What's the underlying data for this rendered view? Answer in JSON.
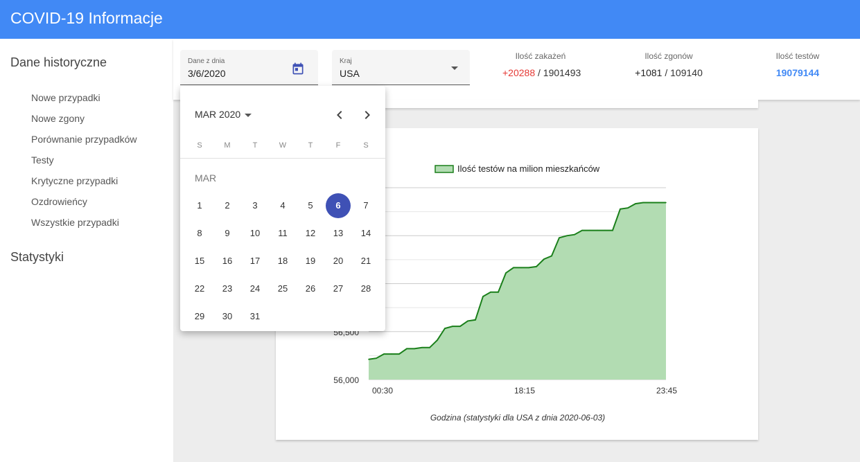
{
  "app": {
    "title": "COVID-19 Informacje"
  },
  "sidebar": {
    "heading_history": "Dane historyczne",
    "items": [
      {
        "label": "Nowe przypadki"
      },
      {
        "label": "Nowe zgony"
      },
      {
        "label": "Porównanie przypadków"
      },
      {
        "label": "Testy"
      },
      {
        "label": "Krytyczne przypadki"
      },
      {
        "label": "Ozdrowieńcy"
      },
      {
        "label": "Wszystkie przypadki"
      }
    ],
    "heading_stats": "Statystyki"
  },
  "filters": {
    "date": {
      "label": "Dane z dnia",
      "value": "3/6/2020",
      "icon": "calendar-icon"
    },
    "country": {
      "label": "Kraj",
      "value": "USA",
      "icon": "chevron-down-icon"
    }
  },
  "stats": {
    "infections": {
      "label": "Ilość zakażeń",
      "delta": "+20288",
      "sep": " / ",
      "total": "1901493"
    },
    "deaths": {
      "label": "Ilość zgonów",
      "delta": "+1081",
      "sep": " / ",
      "total": "109140"
    },
    "tests": {
      "label": "Ilość testów",
      "total": "19079144"
    }
  },
  "datepicker": {
    "period_label": "MAR 2020",
    "month_label": "MAR",
    "weekdays": [
      "S",
      "M",
      "T",
      "W",
      "T",
      "F",
      "S"
    ],
    "first_weekday_index": 0,
    "days_in_month": 31,
    "selected_day": 6,
    "prev_icon": "chevron-left-icon",
    "next_icon": "chevron-right-icon",
    "colors": {
      "selected": "#3f51b5"
    }
  },
  "colors": {
    "header": "#4189f5",
    "delta_cases": "#e53935",
    "tests_total": "#4189f5"
  },
  "chart_data": {
    "type": "area",
    "legend": "Ilość testów na milion mieszkańców",
    "xlabel": "Godzina (statystyki dla USA z dnia 2020-06-03)",
    "ytick_labels": [
      "56,000",
      "56,500"
    ],
    "xtick_labels": [
      "00:30",
      "18:15",
      "23:45"
    ],
    "ylim": [
      56000,
      57800
    ],
    "x": [
      0,
      0.6,
      1.2,
      1.8,
      2.4,
      3.0,
      3.6,
      4.2,
      4.8,
      5.4,
      6.0,
      6.6,
      7.2,
      7.8,
      8.4,
      9.0,
      9.6,
      10.2,
      10.8,
      11.4,
      12.0,
      12.6,
      13.2,
      13.8,
      14.4,
      15.0,
      15.6,
      16.2,
      16.8,
      17.4,
      18.0,
      18.6,
      19.2,
      19.8,
      20.4,
      21.0,
      21.6,
      22.2,
      22.8,
      23.4
    ],
    "values": [
      56190,
      56200,
      56240,
      56240,
      56240,
      56290,
      56290,
      56300,
      56300,
      56370,
      56480,
      56500,
      56500,
      56550,
      56560,
      56780,
      56820,
      56820,
      57000,
      57050,
      57050,
      57050,
      57060,
      57130,
      57160,
      57330,
      57350,
      57360,
      57400,
      57400,
      57400,
      57400,
      57400,
      57600,
      57610,
      57650,
      57660,
      57660,
      57660,
      57660
    ],
    "series_color": "#1a7f1a",
    "fill_color": "#b2dcb2",
    "grid": true
  }
}
